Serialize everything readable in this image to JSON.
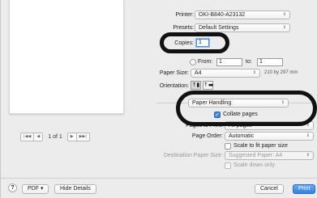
{
  "preview": {
    "page_indicator": "1 of 1",
    "first_glyph": "|◀◀",
    "prev_glyph": "◀",
    "next_glyph": "▶",
    "last_glyph": "▶▶|"
  },
  "printer": {
    "label": "Printer:",
    "value": "OKI-B840-A23132"
  },
  "presets": {
    "label": "Presets:",
    "value": "Default Settings"
  },
  "copies": {
    "label": "Copies:",
    "value": "1"
  },
  "pages": {
    "from_label": "From:",
    "from_value": "1",
    "to_label": "to:",
    "to_value": "1"
  },
  "paper_size": {
    "label": "Paper Size:",
    "value": "A4",
    "dimensions": "210 by 297 mm"
  },
  "orientation": {
    "label": "Orientation:",
    "portrait_glyph": "↑▮",
    "landscape_glyph": "↑▬"
  },
  "section": {
    "value": "Paper Handling"
  },
  "collate": {
    "label": "Collate pages",
    "checked": true
  },
  "pages_to_print": {
    "label": "Pages to Print:",
    "value": "All pages"
  },
  "page_order": {
    "label": "Page Order:",
    "value": "Automatic"
  },
  "scale_fit": {
    "label": "Scale to fit paper size"
  },
  "dest_paper_size": {
    "label": "Destination Paper Size:",
    "value": "Suggested Paper: A4"
  },
  "scale_down": {
    "label": "Scale down only"
  },
  "footer": {
    "help": "?",
    "pdf": "PDF ▾",
    "hide_details": "Hide Details",
    "cancel": "Cancel",
    "print": "Print"
  },
  "popup_arrows": "⇕",
  "colors": {
    "accent": "#3480e6",
    "annotation": "#111111"
  }
}
